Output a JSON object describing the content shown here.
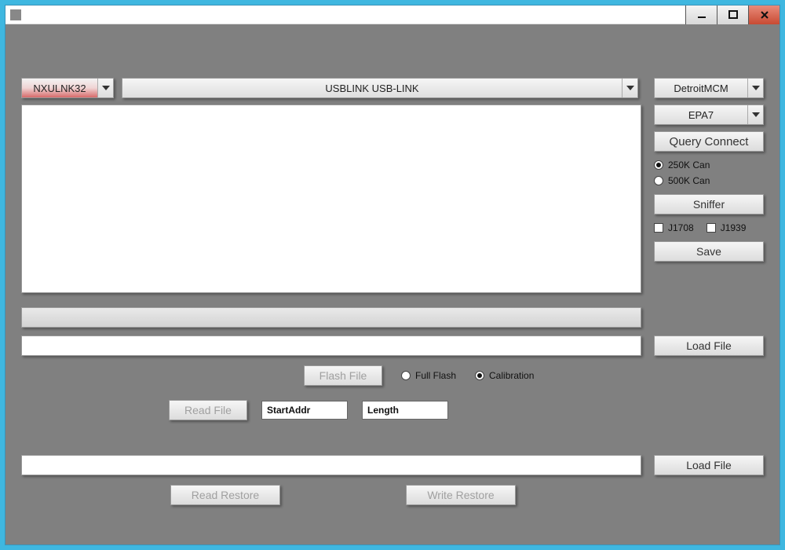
{
  "titlebar": {
    "title": ""
  },
  "top": {
    "adapter_dll": "NXULNK32",
    "adapter_name": "USBLINK USB-LINK"
  },
  "right": {
    "ecu": "DetroitMCM",
    "protocol": "EPA7",
    "query_connect": "Query Connect",
    "can250": "250K Can",
    "can500": "500K Can",
    "sniffer": "Sniffer",
    "j1708": "J1708",
    "j1939": "J1939",
    "save": "Save"
  },
  "load_file": "Load File",
  "flash": {
    "flash_file": "Flash File",
    "full_flash": "Full Flash",
    "calibration": "Calibration"
  },
  "read": {
    "read_file": "Read File",
    "start_addr_ph": "StartAddr",
    "length_ph": "Length"
  },
  "restore": {
    "read": "Read Restore",
    "write": "Write Restore"
  }
}
